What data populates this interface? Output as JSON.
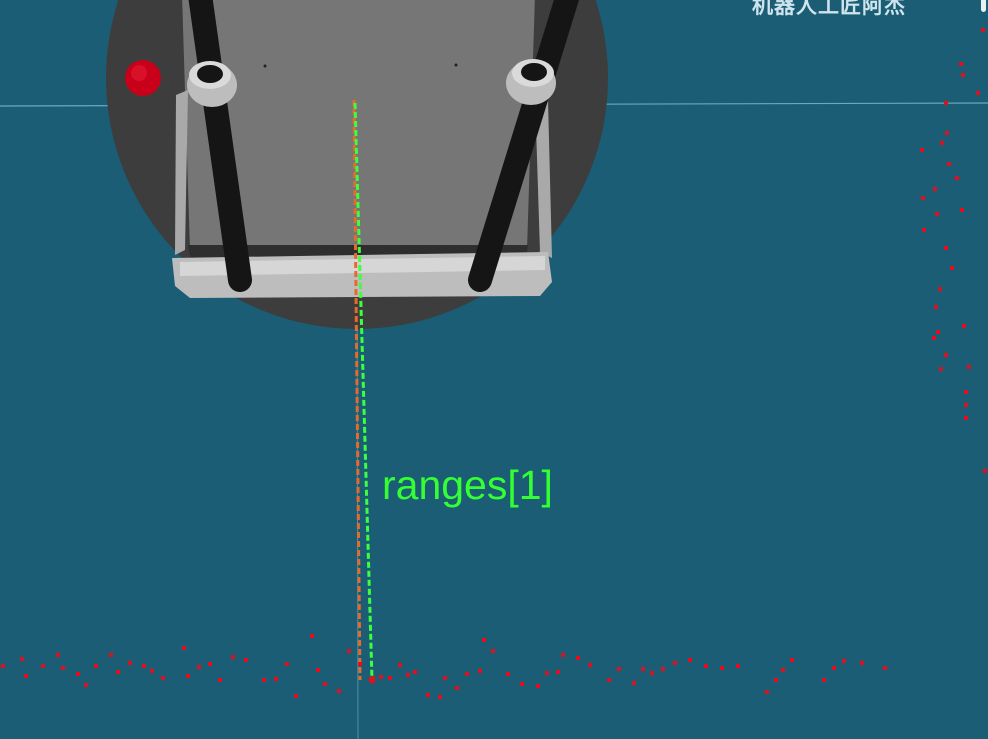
{
  "watermark": {
    "text": "机器人工匠阿杰"
  },
  "beam_label": {
    "text": "ranges[1]"
  },
  "robot": {
    "emergency_stop_color": "#c8001a",
    "base_color": "#3d3d3d",
    "deck_color": "#767676"
  },
  "rays": {
    "reference_color": "#e66a2c",
    "range_color": "#3dff3d"
  },
  "scan_points_color": "#e0101e",
  "background_color": "#1a5d75"
}
